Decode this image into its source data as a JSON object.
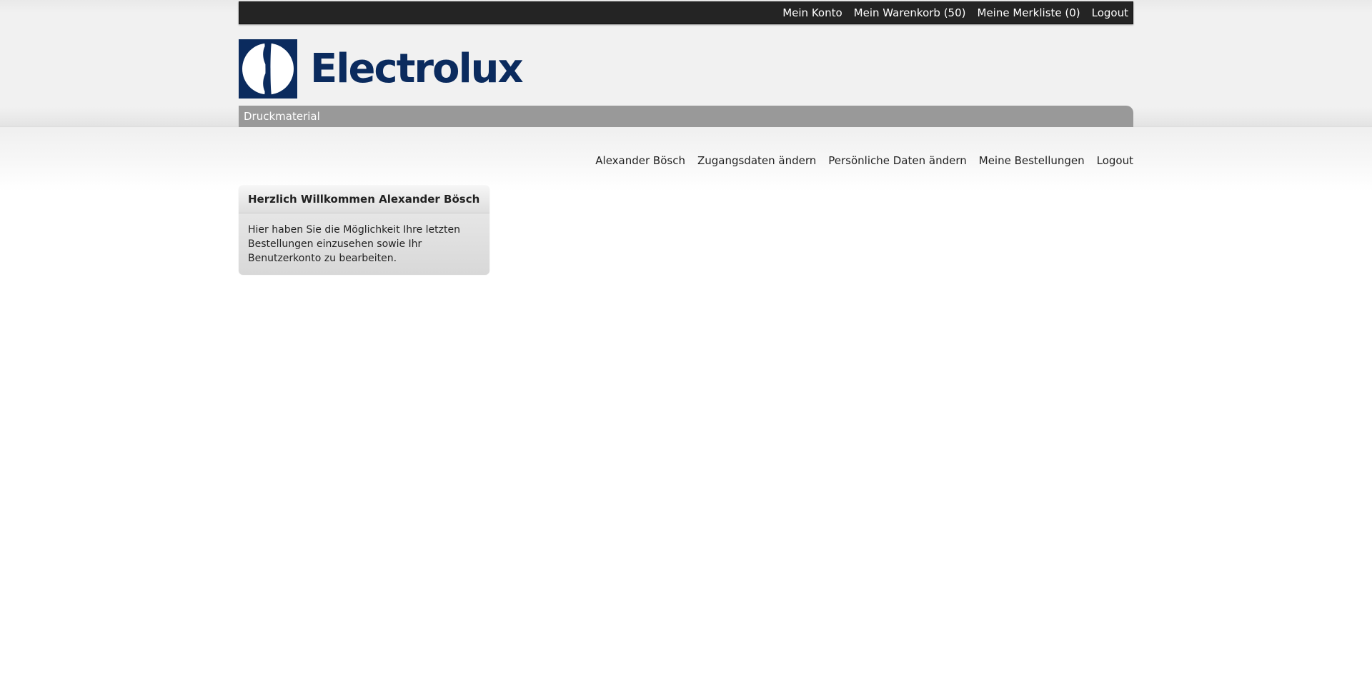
{
  "brand": {
    "name": "Electrolux",
    "color": "#0b2b5e"
  },
  "topbar": {
    "links": [
      {
        "label": "Mein Konto"
      },
      {
        "label": "Mein Warenkorb (50)"
      },
      {
        "label": "Meine Merkliste (0)"
      },
      {
        "label": "Logout"
      }
    ]
  },
  "navbar": {
    "items": [
      {
        "label": "Druckmaterial"
      }
    ]
  },
  "userlinks": {
    "items": [
      {
        "label": "Alexander Bösch"
      },
      {
        "label": "Zugangsdaten ändern"
      },
      {
        "label": "Persönliche Daten ändern"
      },
      {
        "label": "Meine Bestellungen"
      },
      {
        "label": "Logout"
      }
    ]
  },
  "welcome": {
    "title": "Herzlich Willkommen Alexander Bösch",
    "body": "Hier haben Sie die Möglichkeit Ihre letzten Bestellungen einzusehen sowie Ihr Benutzerkonto zu bearbeiten."
  }
}
